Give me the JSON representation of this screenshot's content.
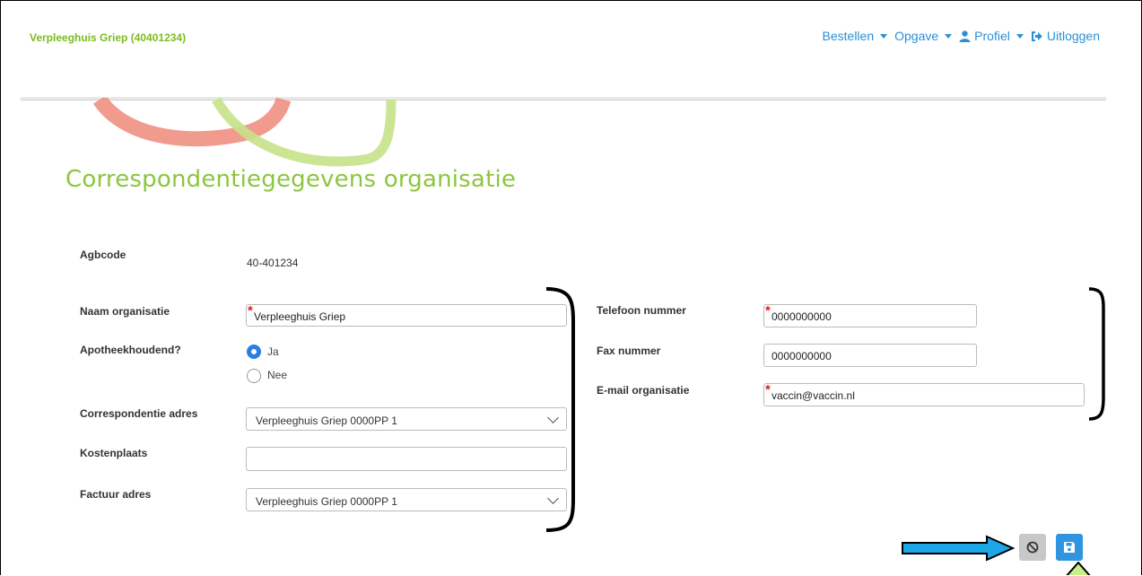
{
  "header": {
    "brand": "Verpleeghuis Griep (40401234)",
    "nav": {
      "bestellen": "Bestellen",
      "opgave": "Opgave",
      "profiel": "Profiel",
      "uitloggen": "Uitloggen"
    }
  },
  "page": {
    "title": "Correspondentiegegevens organisatie"
  },
  "form": {
    "agbcode_label": "Agbcode",
    "agbcode_value": "40-401234",
    "naam_label": "Naam organisatie",
    "naam_value": "Verpleeghuis Griep",
    "apotheek_label": "Apotheekhoudend?",
    "apotheek_options": {
      "ja": "Ja",
      "nee": "Nee"
    },
    "apotheek_selected": "Ja",
    "corr_adres_label": "Correspondentie adres",
    "corr_adres_value": "Verpleeghuis Griep 0000PP 1",
    "kostenplaats_label": "Kostenplaats",
    "kostenplaats_value": "",
    "factuur_label": "Factuur adres",
    "factuur_value": "Verpleeghuis Griep 0000PP 1",
    "telefoon_label": "Telefoon nummer",
    "telefoon_value": "0000000000",
    "fax_label": "Fax nummer",
    "fax_value": "0000000000",
    "email_label": "E-mail organisatie",
    "email_value": "vaccin@vaccin.nl",
    "required_mark": "*"
  },
  "actions": {
    "cancel_icon": "ban-icon",
    "save_icon": "floppy-disk-icon"
  },
  "colors": {
    "brand_green": "#7dbb1e",
    "link_blue": "#2a8fd6",
    "arrow_fill": "#1ea7e6",
    "save_button": "#2f95e0",
    "cancel_button": "#c8c8c8"
  }
}
